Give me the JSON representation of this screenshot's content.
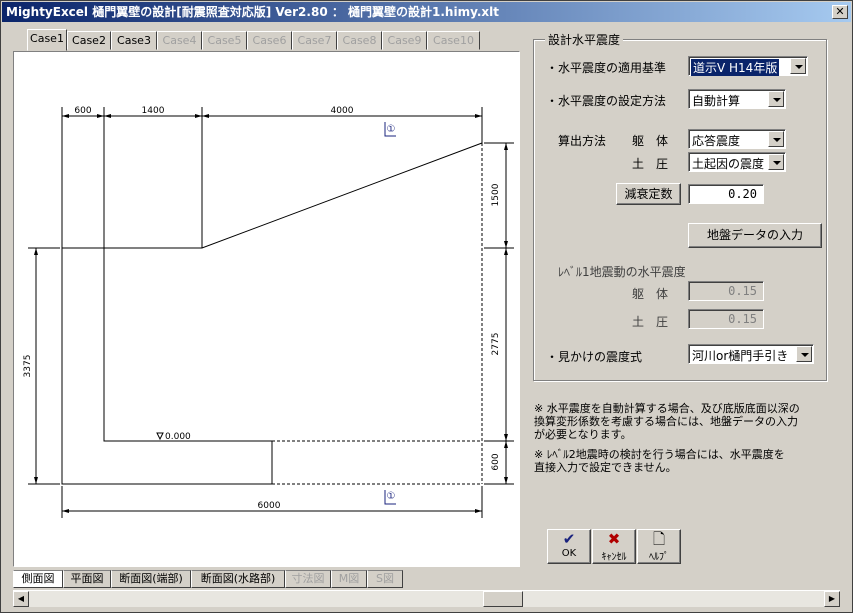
{
  "window": {
    "title": "MightyExcel 樋門翼壁の設計[耐震照査対応版] Ver2.80 ： 樋門翼壁の設計1.himy.xlt",
    "close": "✕"
  },
  "case_tabs": [
    {
      "label": "Case1",
      "enabled": true,
      "active": true
    },
    {
      "label": "Case2",
      "enabled": true
    },
    {
      "label": "Case3",
      "enabled": true
    },
    {
      "label": "Case4",
      "enabled": false
    },
    {
      "label": "Case5",
      "enabled": false
    },
    {
      "label": "Case6",
      "enabled": false
    },
    {
      "label": "Case7",
      "enabled": false
    },
    {
      "label": "Case8",
      "enabled": false
    },
    {
      "label": "Case9",
      "enabled": false
    },
    {
      "label": "Case10",
      "enabled": false
    }
  ],
  "drawing": {
    "dims_top": [
      "600",
      "1400",
      "4000"
    ],
    "dim_right_1": "1500",
    "dim_right_2": "2775",
    "dim_right_3": "600",
    "dim_left": "3375",
    "dim_bottom": "6000",
    "level": "0.000",
    "marker": "①"
  },
  "bottom_tabs": [
    {
      "label": "側面図",
      "active": true
    },
    {
      "label": "平面図"
    },
    {
      "label": "断面図(端部)"
    },
    {
      "label": "断面図(水路部)"
    },
    {
      "label": "寸法図",
      "enabled": false
    },
    {
      "label": "M図",
      "enabled": false
    },
    {
      "label": "S図",
      "enabled": false
    }
  ],
  "panel": {
    "group_title": "設計水平震度",
    "standard_label": "・水平震度の適用基準",
    "standard_value": "道示Ⅴ H14年版",
    "method_label": "・水平震度の設定方法",
    "method_value": "自動計算",
    "calc_label": "算出方法",
    "body_label": "躯　体",
    "body_value": "応答震度",
    "soil_label": "土　圧",
    "soil_value": "土起因の震度",
    "damping_button": "減衰定数",
    "damping_value": "0.20",
    "ground_button": "地盤データの入力",
    "level1_label": "ﾚﾍﾞﾙ1地震動の水平震度",
    "l1_body_label": "躯　体",
    "l1_body_value": "0.15",
    "l1_soil_label": "土　圧",
    "l1_soil_value": "0.15",
    "apparent_label": "・見かけの震度式",
    "apparent_value": "河川or樋門手引き"
  },
  "notes": {
    "note1": [
      "※ 水平震度を自動計算する場合、及び底版底面以深の",
      "換算変形係数を考慮する場合には、地盤データの入力",
      "が必要となります。"
    ],
    "note2": [
      "※ ﾚﾍﾞﾙ2地震時の検討を行う場合には、水平震度を",
      "直接入力で設定できません。"
    ]
  },
  "buttons": {
    "ok": "OK",
    "cancel": "ｷｬﾝｾﾙ",
    "help": "ﾍﾙﾌﾟ"
  }
}
